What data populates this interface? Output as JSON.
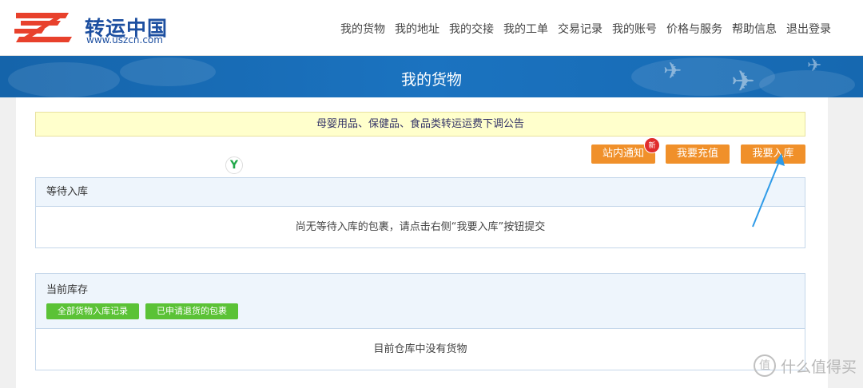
{
  "logo": {
    "name": "转运中国",
    "url": "www.uszcn.com"
  },
  "nav": [
    "我的货物",
    "我的地址",
    "我的交接",
    "我的工单",
    "交易记录",
    "我的账号",
    "价格与服务",
    "帮助信息",
    "退出登录"
  ],
  "banner": {
    "title": "我的货物"
  },
  "notice": "母婴用品、保健品、食品类转运运费下调公告",
  "actions": {
    "inbox": "站内通知",
    "new_badge": "新",
    "recharge": "我要充值",
    "stock_in": "我要入库"
  },
  "pending": {
    "title": "等待入库",
    "empty": "尚无等待入库的包裹，请点击右侧“我要入库”按钮提交"
  },
  "inventory": {
    "title": "当前库存",
    "buttons": [
      "全部货物入库记录",
      "已申请退货的包裹"
    ],
    "empty": "目前仓库中没有货物"
  },
  "watermark": {
    "glyph": "值",
    "text": "什么值得买"
  },
  "colors": {
    "accent_orange": "#f0902a",
    "banner_blue": "#1b73c0",
    "green": "#5bc236",
    "badge_red": "#e02c2c"
  }
}
